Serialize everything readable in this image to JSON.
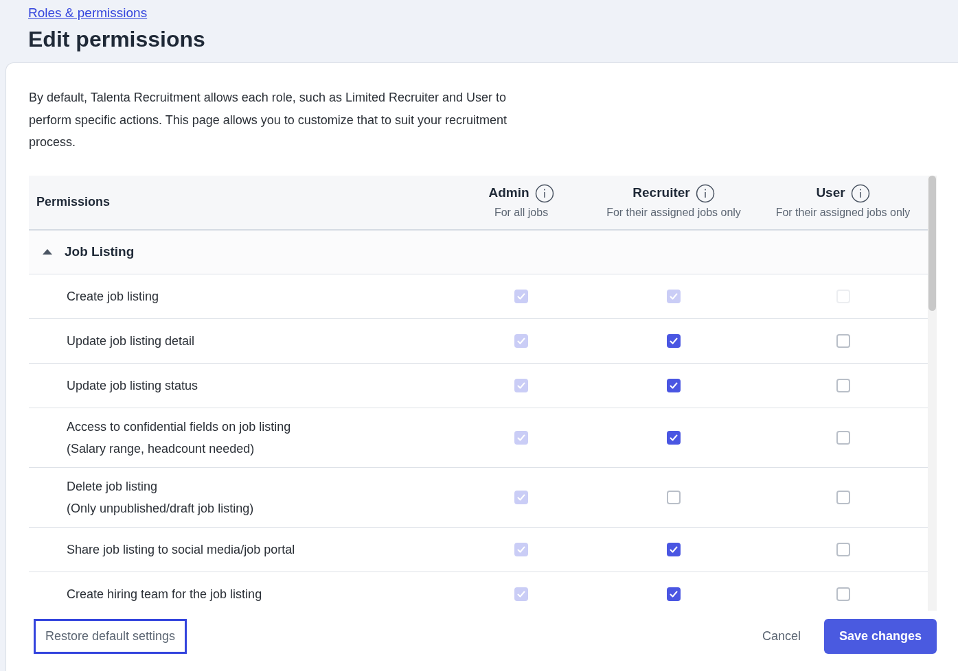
{
  "breadcrumb": "Roles & permissions",
  "title": "Edit permissions",
  "intro": "By default, Talenta Recruitment allows each role, such as Limited Recruiter and User to perform specific actions. This page allows you to customize that to suit your recruitment process.",
  "table": {
    "first_column": "Permissions",
    "roles": [
      {
        "name": "Admin",
        "scope": "For all jobs"
      },
      {
        "name": "Recruiter",
        "scope": "For their assigned jobs only"
      },
      {
        "name": "User",
        "scope": "For their assigned jobs only"
      }
    ],
    "groups": [
      {
        "label": "Job Listing",
        "expanded": true,
        "rows": [
          {
            "lines": [
              "Create job listing"
            ],
            "cells": [
              {
                "checked": true,
                "disabled": true
              },
              {
                "checked": true,
                "disabled": true
              },
              {
                "checked": false,
                "disabled": true
              }
            ]
          },
          {
            "lines": [
              "Update job listing detail"
            ],
            "cells": [
              {
                "checked": true,
                "disabled": true
              },
              {
                "checked": true,
                "disabled": false
              },
              {
                "checked": false,
                "disabled": false
              }
            ]
          },
          {
            "lines": [
              "Update job listing status"
            ],
            "cells": [
              {
                "checked": true,
                "disabled": true
              },
              {
                "checked": true,
                "disabled": false
              },
              {
                "checked": false,
                "disabled": false
              }
            ]
          },
          {
            "lines": [
              "Access to confidential fields on job listing",
              "(Salary range, headcount needed)"
            ],
            "cells": [
              {
                "checked": true,
                "disabled": true
              },
              {
                "checked": true,
                "disabled": false
              },
              {
                "checked": false,
                "disabled": false
              }
            ]
          },
          {
            "lines": [
              "Delete job listing",
              "(Only unpublished/draft job listing)"
            ],
            "cells": [
              {
                "checked": true,
                "disabled": true
              },
              {
                "checked": false,
                "disabled": false
              },
              {
                "checked": false,
                "disabled": false
              }
            ]
          },
          {
            "lines": [
              "Share job listing to social media/job portal"
            ],
            "cells": [
              {
                "checked": true,
                "disabled": true
              },
              {
                "checked": true,
                "disabled": false
              },
              {
                "checked": false,
                "disabled": false
              }
            ]
          },
          {
            "lines": [
              "Create hiring team for the job listing"
            ],
            "cells": [
              {
                "checked": true,
                "disabled": true
              },
              {
                "checked": true,
                "disabled": false
              },
              {
                "checked": false,
                "disabled": false
              }
            ]
          }
        ]
      }
    ]
  },
  "footer": {
    "restore": {
      "label": "Restore default settings",
      "focused": true
    },
    "cancel": "Cancel",
    "save": "Save changes"
  }
}
